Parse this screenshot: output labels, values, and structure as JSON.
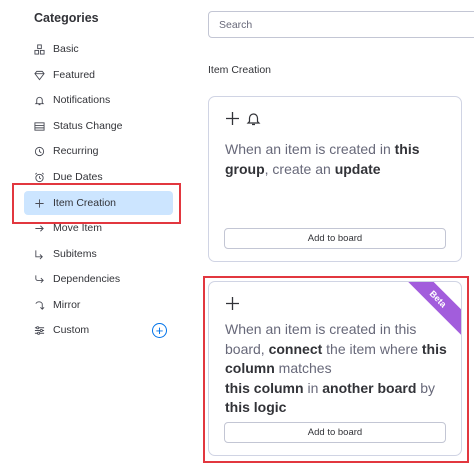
{
  "sidebar": {
    "title": "Categories",
    "items": [
      {
        "label": "Basic",
        "icon": "basic-icon"
      },
      {
        "label": "Featured",
        "icon": "diamond-icon"
      },
      {
        "label": "Notifications",
        "icon": "bell-icon"
      },
      {
        "label": "Status Change",
        "icon": "status-icon"
      },
      {
        "label": "Recurring",
        "icon": "clock-icon"
      },
      {
        "label": "Due Dates",
        "icon": "alarm-icon"
      },
      {
        "label": "Item Creation",
        "icon": "plus-icon",
        "selected": true
      },
      {
        "label": "Move Item",
        "icon": "arrow-right-icon"
      },
      {
        "label": "Subitems",
        "icon": "subitems-icon"
      },
      {
        "label": "Dependencies",
        "icon": "dependencies-icon"
      },
      {
        "label": "Mirror",
        "icon": "mirror-icon"
      },
      {
        "label": "Custom",
        "icon": "sliders-icon"
      }
    ],
    "add_custom_label": "+"
  },
  "search": {
    "placeholder": "Search",
    "value": ""
  },
  "main": {
    "section_title": "Item Creation",
    "card1": {
      "recipe_parts": [
        "When an item is created in ",
        "this group",
        ", create an ",
        "update"
      ],
      "button": "Add to board"
    },
    "card2": {
      "badge": "Beta",
      "recipe_parts": [
        "When an item is created in this board, ",
        "connect",
        " the item where ",
        "this column",
        " matches ",
        "this column",
        " in ",
        "another board",
        " by ",
        "this logic"
      ],
      "button": "Add to board"
    }
  },
  "colors": {
    "accent": "#0073ea",
    "selected_bg": "#cce5ff",
    "highlight": "#e2373f",
    "beta": "#a25ddc"
  }
}
